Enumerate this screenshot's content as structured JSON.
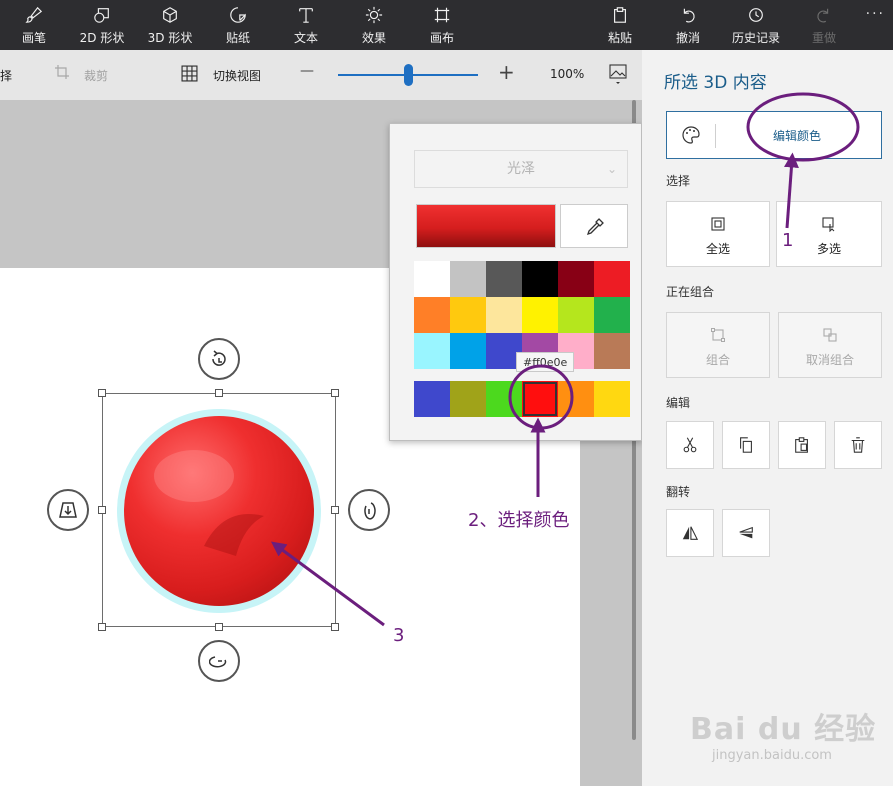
{
  "toolbar": {
    "tools": [
      {
        "label": "画笔",
        "icon": "brush-icon"
      },
      {
        "label": "2D 形状",
        "icon": "2d-shapes-icon"
      },
      {
        "label": "3D 形状",
        "icon": "3d-shapes-icon"
      },
      {
        "label": "贴纸",
        "icon": "sticker-icon"
      },
      {
        "label": "文本",
        "icon": "text-icon"
      },
      {
        "label": "效果",
        "icon": "effects-icon"
      },
      {
        "label": "画布",
        "icon": "canvas-icon"
      }
    ],
    "right": [
      {
        "label": "粘贴",
        "icon": "paste-icon"
      },
      {
        "label": "撤消",
        "icon": "undo-icon"
      },
      {
        "label": "历史记录",
        "icon": "history-icon"
      },
      {
        "label": "重做",
        "icon": "redo-icon",
        "disabled": true
      }
    ],
    "more": "···"
  },
  "subbar": {
    "select_partial": "择",
    "crop": "裁剪",
    "switch_view": "切换视图",
    "zoom_minus": "—",
    "zoom_plus": "+",
    "zoom_percent": "100%",
    "zoom_level": 0.5
  },
  "color_popup": {
    "finish": "光泽",
    "swatches": [
      [
        "#ffffff",
        "#c3c3c3",
        "#585858",
        "#000000",
        "#880015",
        "#ed1c24"
      ],
      [
        "#ff7f27",
        "#ffc90e",
        "#fde69c",
        "#fff200",
        "#b5e61d",
        "#22b14c"
      ],
      [
        "#99f5ff",
        "#00a2e8",
        "#3f48cc",
        "#a349a4",
        "#ffaec9",
        "#b97a57"
      ],
      [
        "#3f48cc",
        "#a0a319",
        "#4cd91e",
        "#ff0e0e",
        "#ff8f11",
        "#ffd811"
      ]
    ],
    "tooltip": "#ff0e0e",
    "selected_color": "#ff0e0e"
  },
  "panel": {
    "title": "所选 3D 内容",
    "edit_color": "编辑颜色",
    "section_select": "选择",
    "select_all": "全选",
    "multi_select": "多选",
    "section_group": "正在组合",
    "group": "组合",
    "ungroup": "取消组合",
    "section_edit": "编辑",
    "section_flip": "翻转"
  },
  "annotations": {
    "a1": "1",
    "a2": "2、选择颜色",
    "a3": "3",
    "color": "#6b1e7d"
  },
  "watermark": {
    "logo_text": "Bai du 经验",
    "url": "jingyan.baidu.com"
  }
}
